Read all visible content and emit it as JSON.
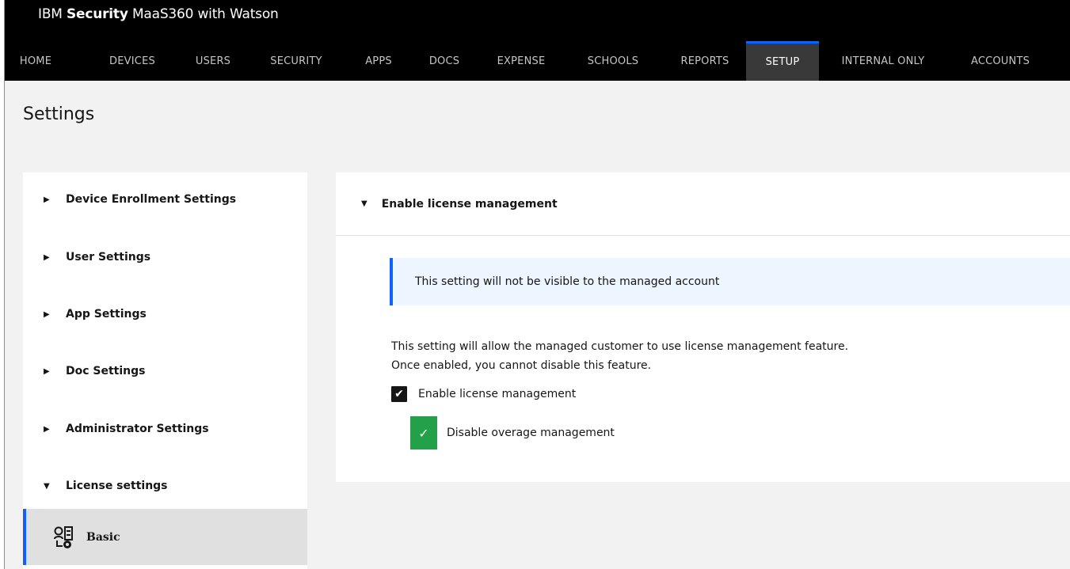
{
  "header": {
    "brand_prefix": "IBM ",
    "brand_bold": "Security",
    "brand_suffix": " MaaS360 with Watson"
  },
  "nav": {
    "items": [
      {
        "label": "HOME"
      },
      {
        "label": "DEVICES"
      },
      {
        "label": "USERS"
      },
      {
        "label": "SECURITY"
      },
      {
        "label": "APPS"
      },
      {
        "label": "DOCS"
      },
      {
        "label": "EXPENSE"
      },
      {
        "label": "SCHOOLS"
      },
      {
        "label": "REPORTS"
      },
      {
        "label": "SETUP"
      },
      {
        "label": "INTERNAL ONLY"
      },
      {
        "label": "ACCOUNTS"
      }
    ],
    "active": "SETUP"
  },
  "page": {
    "title": "Settings"
  },
  "sidebar": {
    "items": [
      {
        "label": "Device Enrollment Settings",
        "expanded": false
      },
      {
        "label": "User Settings",
        "expanded": false
      },
      {
        "label": "App Settings",
        "expanded": false
      },
      {
        "label": "Doc Settings",
        "expanded": false
      },
      {
        "label": "Administrator Settings",
        "expanded": false
      },
      {
        "label": "License settings",
        "expanded": true
      }
    ],
    "sub_item": {
      "label": "Basic",
      "icon": "license-settings-icon",
      "selected": true
    }
  },
  "main": {
    "section_title": "Enable license management",
    "notice": "This setting will not be visible to the managed account",
    "description_line1": "This setting will allow the managed customer to use license management feature.",
    "description_line2": "Once enabled, you cannot disable this feature.",
    "checkbox_enable": {
      "label": "Enable license management",
      "checked": true
    },
    "checkbox_overage": {
      "label": "Disable overage management",
      "checked": true
    }
  },
  "colors": {
    "accent": "#0f62fe",
    "success": "#24a148",
    "nav_bg": "#000000",
    "nav_active_bg": "#393939",
    "notice_bg": "#edf5ff"
  }
}
